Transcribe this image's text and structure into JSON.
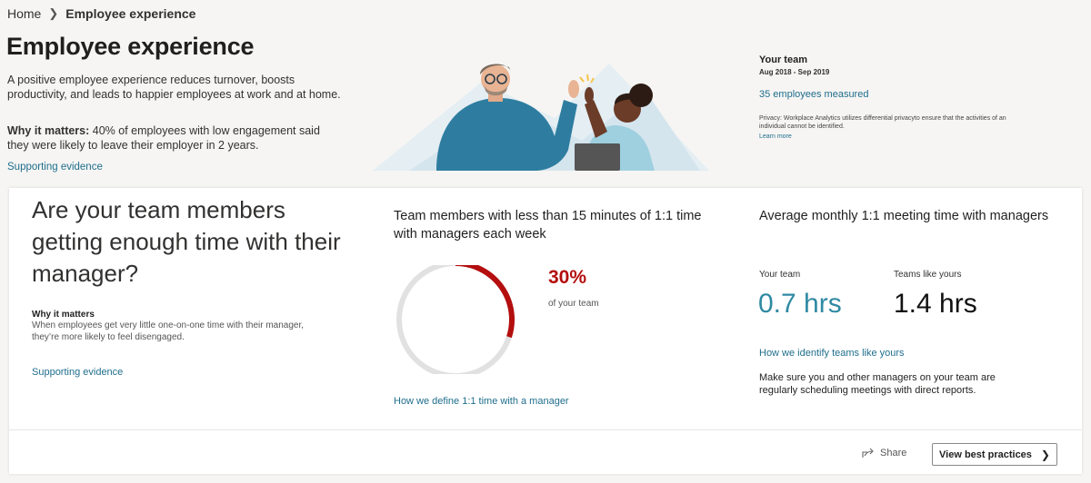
{
  "breadcrumb": {
    "home": "Home",
    "current": "Employee experience"
  },
  "header": {
    "title": "Employee experience",
    "description": "A positive employee experience reduces turnover, boosts productivity, and leads to happier employees at work and at home.",
    "why_label": "Why it matters:",
    "why_text": " 40% of employees with low engagement said they were likely to leave their employer in 2 years.",
    "supporting_evidence": "Supporting evidence"
  },
  "team": {
    "heading": "Your team",
    "dates": "Aug 2018 - Sep 2019",
    "measured": "35 employees measured",
    "privacy": "Privacy: Workplace Analytics utilizes differential privacyto ensure that the activities of an individual cannot be identified.",
    "learn_more": "Learn more"
  },
  "card": {
    "question": "Are your team members getting enough time with their manager?",
    "why_heading": "Why it matters",
    "why_text": "When employees get very little one-on-one time with their manager, they’re more likely to feel disengaged.",
    "supporting_evidence": "Supporting evidence",
    "metric1": {
      "title": "Team members with less than 15 minutes of 1:1 time with managers each week",
      "percent": "30%",
      "percent_value": 30,
      "percent_label": "of your team",
      "link": "How we define 1:1 time with a manager"
    },
    "metric2": {
      "title": "Average monthly 1:1 meeting time with managers",
      "your_team_label": "Your team",
      "your_team_value": "0.7 hrs",
      "teams_like_label": "Teams like yours",
      "teams_like_value": "1.4 hrs",
      "link": "How we identify teams like yours",
      "advice": "Make sure you and other managers on your team are regularly scheduling meetings with direct reports."
    },
    "share_label": "Share",
    "best_practices_label": "View best practices"
  },
  "colors": {
    "accent_link": "#1f6e8c",
    "donut_fill": "#b40e0e",
    "donut_track": "#e1e1e1",
    "your_team_value": "#2f8aa3"
  },
  "icons": [
    "chevron-right-icon",
    "share-icon",
    "chevron-right-icon"
  ]
}
